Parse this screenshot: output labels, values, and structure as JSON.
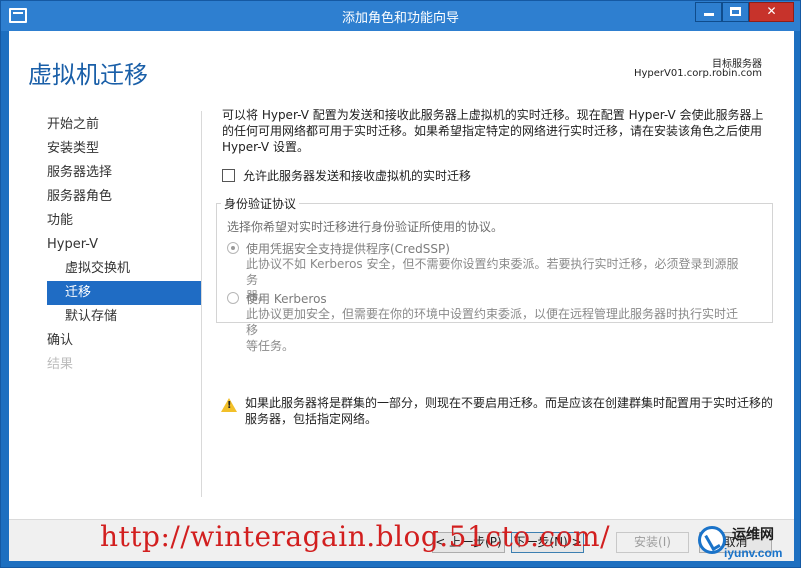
{
  "window": {
    "title": "添加角色和功能向导",
    "minimize": "minimize",
    "maximize": "maximize",
    "close": "✕"
  },
  "header": {
    "page_title": "虚拟机迁移",
    "dest_label": "目标服务器",
    "dest_value": "HyperV01.corp.robin.com"
  },
  "nav": {
    "items": [
      {
        "label": "开始之前",
        "state": "normal"
      },
      {
        "label": "安装类型",
        "state": "normal"
      },
      {
        "label": "服务器选择",
        "state": "normal"
      },
      {
        "label": "服务器角色",
        "state": "normal"
      },
      {
        "label": "功能",
        "state": "normal"
      },
      {
        "label": "Hyper-V",
        "state": "normal"
      },
      {
        "label": "虚拟交换机",
        "state": "sub"
      },
      {
        "label": "迁移",
        "state": "active"
      },
      {
        "label": "默认存储",
        "state": "sub"
      },
      {
        "label": "确认",
        "state": "normal"
      },
      {
        "label": "结果",
        "state": "disabled"
      }
    ]
  },
  "content": {
    "intro_line1": "可以将 Hyper-V 配置为发送和接收此服务器上虚拟机的实时迁移。现在配置 Hyper-V 会使此服务器上",
    "intro_line2": "的任何可用网络都可用于实时迁移。如果希望指定特定的网络进行实时迁移，请在安装该角色之后使用",
    "intro_line3": "Hyper-V 设置。",
    "checkbox_label": "允许此服务器发送和接收虚拟机的实时迁移",
    "checkbox_checked": false,
    "auth_group": {
      "legend": "身份验证协议",
      "description": "选择你希望对实时迁移进行身份验证所使用的协议。",
      "option1_label": "使用凭据安全支持提供程序(CredSSP)",
      "option1_desc_1": "此协议不如 Kerberos 安全，但不需要你设置约束委派。若要执行实时迁移，必须登录到源服务",
      "option1_desc_2": "器。",
      "option2_label": "使用 Kerberos",
      "option2_desc_1": "此协议更加安全，但需要在你的环境中设置约束委派，以便在远程管理此服务器时执行实时迁移",
      "option2_desc_2": "等任务。",
      "selected": "option1"
    },
    "warning_line1": "如果此服务器将是群集的一部分，则现在不要启用迁移。而是应该在创建群集时配置用于实时迁移的",
    "warning_line2": "服务器，包括指定网络。"
  },
  "footer": {
    "prev": "< 上一步(P)",
    "next": "下一步(N) >",
    "install": "安装(I)",
    "cancel": "取消"
  },
  "overlay": {
    "watermark": "http://winteragain.blog.51cto.com/",
    "logo_top": "运维网",
    "logo_bottom": "iyunv.com"
  },
  "colors": {
    "accent": "#1f6cc4",
    "titlebar": "#2e7fd0",
    "close": "#c7332b",
    "warning": "#f2c029",
    "watermark": "#d21f1f"
  }
}
